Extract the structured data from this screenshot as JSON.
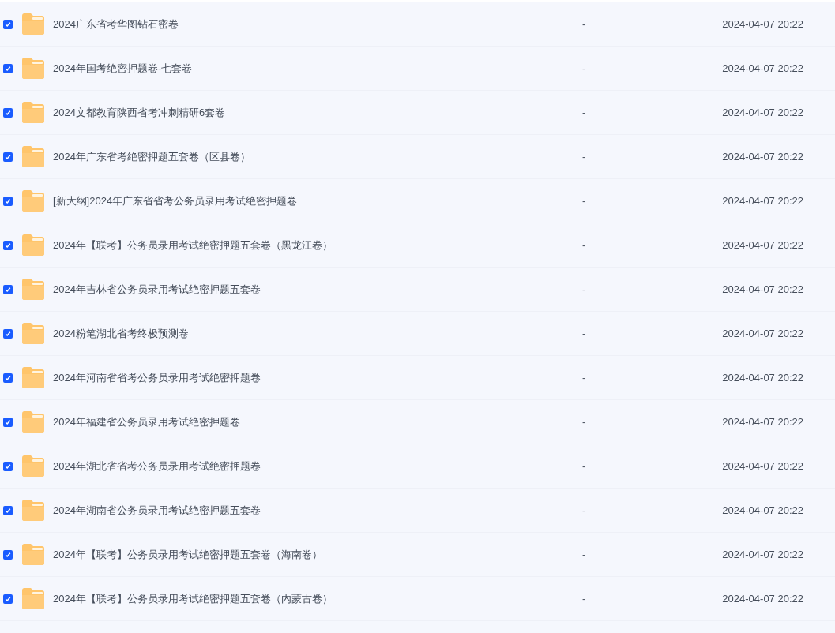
{
  "rows": [
    {
      "name": "2024广东省考华图钻石密卷",
      "size": "-",
      "modified": "2024-04-07 20:22",
      "checked": true
    },
    {
      "name": "2024年国考绝密押题卷-七套卷",
      "size": "-",
      "modified": "2024-04-07 20:22",
      "checked": true
    },
    {
      "name": "2024文都教育陕西省考冲刺精研6套卷",
      "size": "-",
      "modified": "2024-04-07 20:22",
      "checked": true
    },
    {
      "name": "2024年广东省考绝密押题五套卷（区县卷）",
      "size": "-",
      "modified": "2024-04-07 20:22",
      "checked": true
    },
    {
      "name": "[新大纲]2024年广东省省考公务员录用考试绝密押题卷",
      "size": "-",
      "modified": "2024-04-07 20:22",
      "checked": true
    },
    {
      "name": "2024年【联考】公务员录用考试绝密押题五套卷（黑龙江卷）",
      "size": "-",
      "modified": "2024-04-07 20:22",
      "checked": true
    },
    {
      "name": "2024年吉林省公务员录用考试绝密押题五套卷",
      "size": "-",
      "modified": "2024-04-07 20:22",
      "checked": true
    },
    {
      "name": "2024粉笔湖北省考终极预测卷",
      "size": "-",
      "modified": "2024-04-07 20:22",
      "checked": true
    },
    {
      "name": "2024年河南省省考公务员录用考试绝密押题卷",
      "size": "-",
      "modified": "2024-04-07 20:22",
      "checked": true
    },
    {
      "name": "2024年福建省公务员录用考试绝密押题卷",
      "size": "-",
      "modified": "2024-04-07 20:22",
      "checked": true
    },
    {
      "name": "2024年湖北省省考公务员录用考试绝密押题卷",
      "size": "-",
      "modified": "2024-04-07 20:22",
      "checked": true
    },
    {
      "name": "2024年湖南省公务员录用考试绝密押题五套卷",
      "size": "-",
      "modified": "2024-04-07 20:22",
      "checked": true
    },
    {
      "name": "2024年【联考】公务员录用考试绝密押题五套卷（海南卷）",
      "size": "-",
      "modified": "2024-04-07 20:22",
      "checked": true
    },
    {
      "name": "2024年【联考】公务员录用考试绝密押题五套卷（内蒙古卷）",
      "size": "-",
      "modified": "2024-04-07 20:22",
      "checked": true
    }
  ]
}
